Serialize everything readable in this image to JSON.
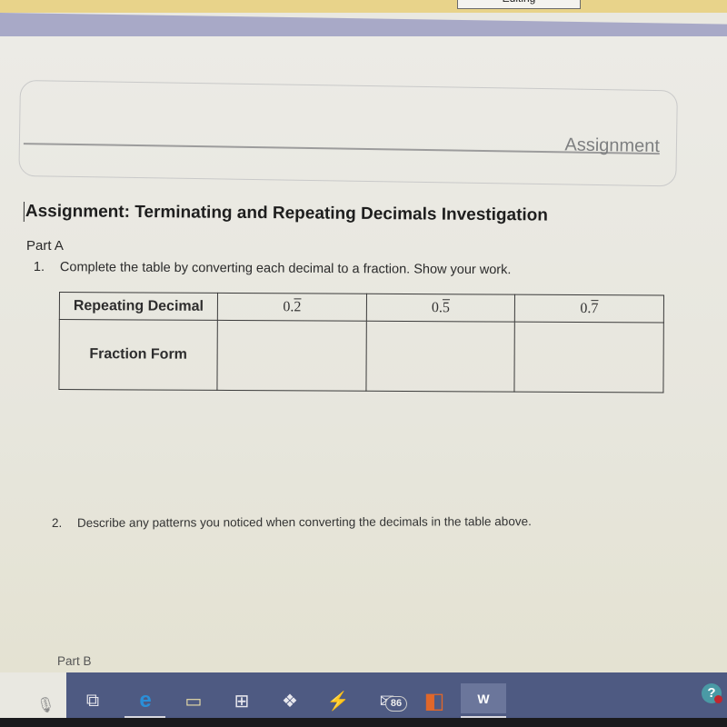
{
  "message_bar": {
    "button_label": "Editing",
    "color": "#e8d38a"
  },
  "header": {
    "label": "Assignment"
  },
  "document": {
    "title": "Assignment: Terminating and Repeating Decimals Investigation",
    "part_a": "Part A",
    "question_1": {
      "number": "1.",
      "text": "Complete the table by converting each decimal to a fraction. Show your work."
    },
    "table": {
      "row_headers": [
        "Repeating Decimal",
        "Fraction Form"
      ],
      "decimals": [
        {
          "whole": "0.",
          "repeat": "2"
        },
        {
          "whole": "0.",
          "repeat": "5"
        },
        {
          "whole": "0.",
          "repeat": "7"
        }
      ],
      "fractions": [
        "",
        "",
        ""
      ]
    },
    "question_2": {
      "number": "2.",
      "text": "Describe any patterns you noticed when converting the decimals in the table above."
    },
    "part_b": "Part B"
  },
  "taskbar": {
    "color": "#4e5a82",
    "icons": [
      {
        "name": "microphone",
        "glyph": "🎙"
      },
      {
        "name": "task-view",
        "glyph": "⧉"
      },
      {
        "name": "edge",
        "glyph": "e"
      },
      {
        "name": "file-explorer",
        "glyph": "▭"
      },
      {
        "name": "store",
        "glyph": "⊞"
      },
      {
        "name": "dropbox",
        "glyph": "❖"
      },
      {
        "name": "app-bolt",
        "glyph": "⚡"
      },
      {
        "name": "mail",
        "glyph": "✉"
      },
      {
        "name": "office",
        "glyph": "◧"
      },
      {
        "name": "word",
        "glyph": "W"
      }
    ],
    "mail_badge": "86",
    "help_glyph": "?"
  }
}
